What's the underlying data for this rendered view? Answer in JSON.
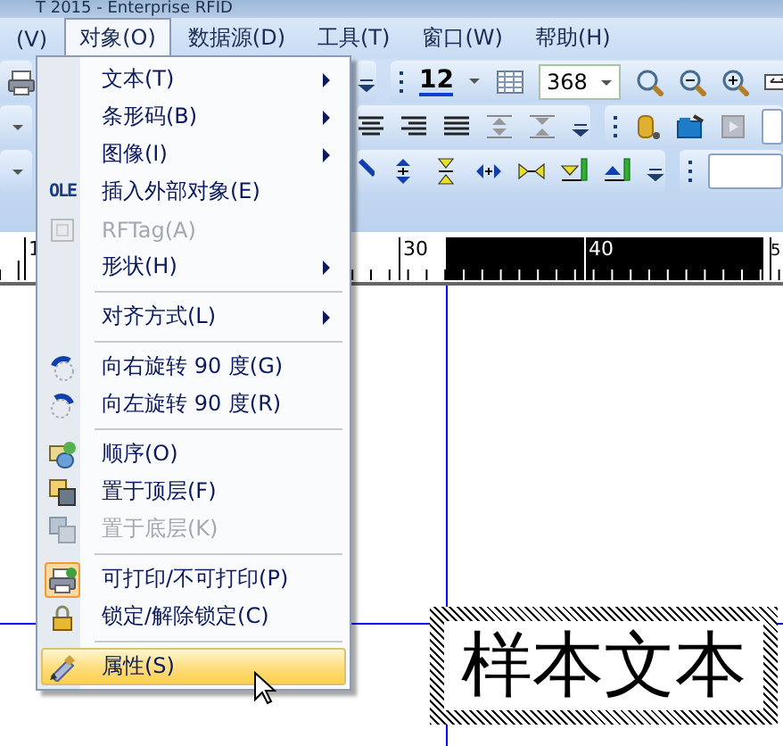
{
  "window": {
    "title": "T 2015 - Enterprise RFID"
  },
  "menubar": [
    {
      "label": "(V)",
      "selected": false
    },
    {
      "label": "对象(O)",
      "selected": true
    },
    {
      "label": "数据源(D)",
      "selected": false
    },
    {
      "label": "工具(T)",
      "selected": false
    },
    {
      "label": "窗口(W)",
      "selected": false
    },
    {
      "label": "帮助(H)",
      "selected": false
    }
  ],
  "toolbar": {
    "font_size": "12",
    "zoom": "368"
  },
  "ruler": {
    "labels": [
      "1",
      "30",
      "40",
      "5"
    ]
  },
  "canvas": {
    "sample_text": "样本文本"
  },
  "context_menu": {
    "items": [
      {
        "kind": "item",
        "label": "文本(T)",
        "submenu": true,
        "disabled": false,
        "checked": false,
        "selected": false
      },
      {
        "kind": "item",
        "label": "条形码(B)",
        "submenu": true,
        "disabled": false,
        "checked": false,
        "selected": false
      },
      {
        "kind": "item",
        "label": "图像(I)",
        "submenu": true,
        "disabled": false,
        "checked": false,
        "selected": false
      },
      {
        "kind": "item",
        "label": "插入外部对象(E)",
        "icon_text": "OLE",
        "submenu": false,
        "disabled": false,
        "checked": false,
        "selected": false
      },
      {
        "kind": "item",
        "label": "RFTag(A)",
        "submenu": false,
        "disabled": true,
        "checked": false,
        "selected": false
      },
      {
        "kind": "item",
        "label": "形状(H)",
        "submenu": true,
        "disabled": false,
        "checked": false,
        "selected": false
      },
      {
        "kind": "separator"
      },
      {
        "kind": "item",
        "label": "对齐方式(L)",
        "submenu": true,
        "disabled": false,
        "checked": false,
        "selected": false
      },
      {
        "kind": "separator"
      },
      {
        "kind": "item",
        "label": "向右旋转 90 度(G)",
        "submenu": false,
        "disabled": false,
        "checked": false,
        "selected": false
      },
      {
        "kind": "item",
        "label": "向左旋转 90 度(R)",
        "submenu": false,
        "disabled": false,
        "checked": false,
        "selected": false
      },
      {
        "kind": "separator"
      },
      {
        "kind": "item",
        "label": "顺序(O)",
        "submenu": false,
        "disabled": false,
        "checked": false,
        "selected": false
      },
      {
        "kind": "item",
        "label": "置于顶层(F)",
        "submenu": false,
        "disabled": false,
        "checked": false,
        "selected": false
      },
      {
        "kind": "item",
        "label": "置于底层(K)",
        "submenu": false,
        "disabled": true,
        "checked": false,
        "selected": false
      },
      {
        "kind": "separator"
      },
      {
        "kind": "item",
        "label": "可打印/不可打印(P)",
        "submenu": false,
        "disabled": false,
        "checked": true,
        "selected": false
      },
      {
        "kind": "item",
        "label": "锁定/解除锁定(C)",
        "submenu": false,
        "disabled": false,
        "checked": false,
        "selected": false
      },
      {
        "kind": "separator"
      },
      {
        "kind": "item",
        "label": "属性(S)",
        "submenu": false,
        "disabled": false,
        "checked": false,
        "selected": true
      }
    ]
  }
}
